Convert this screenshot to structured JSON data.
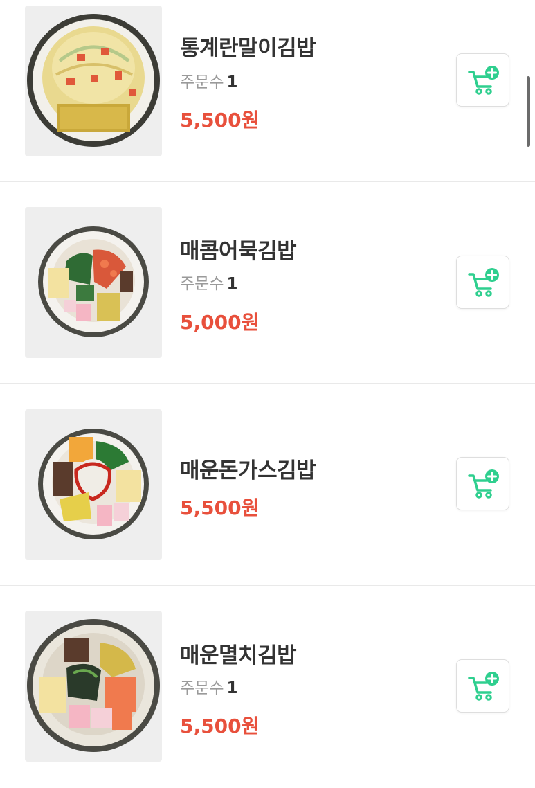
{
  "menu": {
    "order_label": "주문수",
    "items": [
      {
        "name": "통계란말이김밥",
        "order_count": "1",
        "price": "5,500원"
      },
      {
        "name": "매콤어묵김밥",
        "order_count": "1",
        "price": "5,000원"
      },
      {
        "name": "매운돈가스김밥",
        "price": "5,500원"
      },
      {
        "name": "매운멸치김밥",
        "order_count": "1",
        "price": "5,500원"
      }
    ]
  },
  "colors": {
    "price": "#e8503c",
    "cart_icon": "#2fcf8f",
    "divider": "#e9e9e9"
  },
  "icons": {
    "cart_button": "cart-plus-icon"
  }
}
